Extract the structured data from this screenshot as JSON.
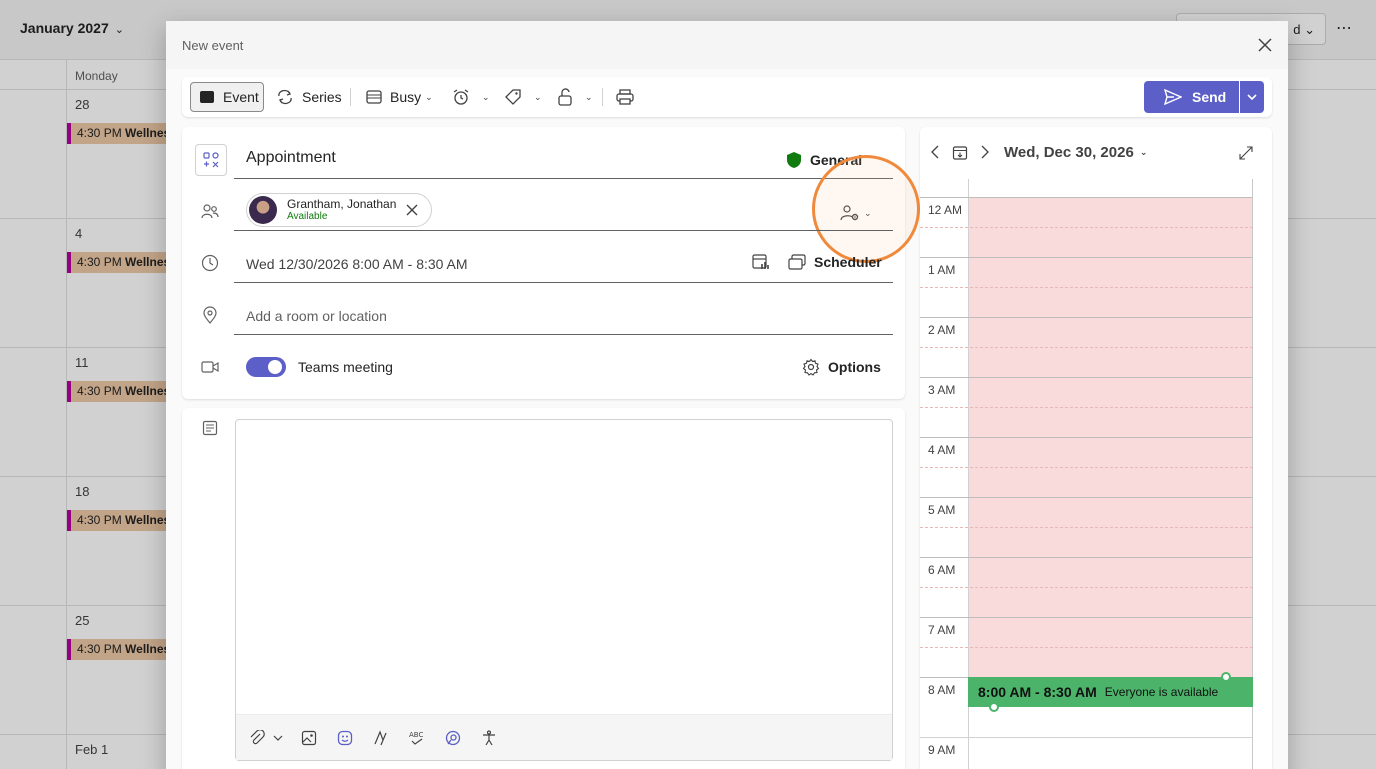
{
  "background": {
    "month_label": "January 2027",
    "day_header": "Monday",
    "right_button_label": "d",
    "weeks": [
      {
        "day": "28",
        "event_time": "4:30 PM",
        "event_title": "Wellnes"
      },
      {
        "day": "4",
        "event_time": "4:30 PM",
        "event_title": "Wellnes"
      },
      {
        "day": "11",
        "event_time": "4:30 PM",
        "event_title": "Wellnes"
      },
      {
        "day": "18",
        "event_time": "4:30 PM",
        "event_title": "Wellnes"
      },
      {
        "day": "25",
        "event_time": "4:30 PM",
        "event_title": "Wellnes"
      },
      {
        "day": "Feb 1",
        "event_time": "",
        "event_title": ""
      }
    ]
  },
  "dialog": {
    "title": "New event",
    "toolbar": {
      "event_label": "Event",
      "series_label": "Series",
      "busy_label": "Busy",
      "send_label": "Send"
    },
    "form": {
      "title_value": "Appointment",
      "category_label": "General",
      "attendee": {
        "name": "Grantham, Jonathan",
        "status": "Available"
      },
      "date_value": "Wed 12/30/2026 8:00 AM - 8:30 AM",
      "scheduler_label": "Scheduler",
      "location_placeholder": "Add a room or location",
      "teams_label": "Teams meeting",
      "teams_enabled": true,
      "options_label": "Options"
    },
    "schedule": {
      "date_label": "Wed, Dec 30, 2026",
      "hours": [
        "12 AM",
        "1 AM",
        "2 AM",
        "3 AM",
        "4 AM",
        "5 AM",
        "6 AM",
        "7 AM",
        "8 AM",
        "9 AM"
      ],
      "slot_time": "8:00 AM - 8:30 AM",
      "slot_status": "Everyone is available"
    }
  },
  "colors": {
    "accent": "#5b5fc7",
    "available": "#4bb46a",
    "busy": "#fadbdb",
    "highlight": "#ef8a3c",
    "event_bg": "#edc9a7"
  }
}
